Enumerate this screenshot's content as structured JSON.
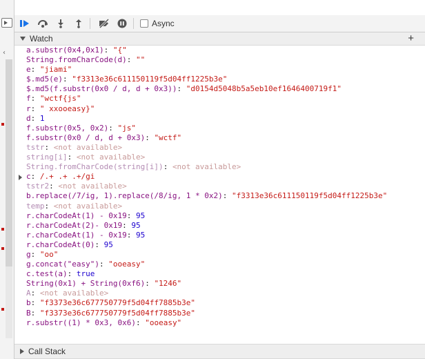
{
  "toolbar": {
    "async_label": "Async"
  },
  "watch": {
    "title": "Watch",
    "add_symbol": "+",
    "items": [
      {
        "expr": "a.substr(0x4,0x1)",
        "value": "\"{\"",
        "kind": "str",
        "na": false
      },
      {
        "expr": "String.fromCharCode(d)",
        "value": "\"\"",
        "kind": "str",
        "na": false
      },
      {
        "expr": "e",
        "value": "\"jiami\"",
        "kind": "str",
        "na": false
      },
      {
        "expr": "$.md5(e)",
        "value": "\"f3313e36c611150119f5d04ff1225b3e\"",
        "kind": "str",
        "na": false
      },
      {
        "expr": "$.md5(f.substr(0x0 / d, d + 0x3))",
        "value": "\"d0154d5048b5a5eb10ef1646400719f1\"",
        "kind": "str",
        "na": false
      },
      {
        "expr": "f",
        "value": "\"wctf{js\"",
        "kind": "str",
        "na": false
      },
      {
        "expr": "r",
        "value": "\" xxooeasy}\"",
        "kind": "str",
        "na": false
      },
      {
        "expr": "d",
        "value": "1",
        "kind": "num",
        "na": false
      },
      {
        "expr": "f.substr(0x5, 0x2)",
        "value": "\"js\"",
        "kind": "str",
        "na": false
      },
      {
        "expr": "f.substr(0x0 / d, d + 0x3)",
        "value": "\"wctf\"",
        "kind": "str",
        "na": false
      },
      {
        "expr": "tstr",
        "value": "<not available>",
        "kind": "na",
        "na": true
      },
      {
        "expr": "string[i]",
        "value": "<not available>",
        "kind": "na",
        "na": true
      },
      {
        "expr": "String.fromCharCode(string[i])",
        "value": "<not available>",
        "kind": "na",
        "na": true
      },
      {
        "expr": "c",
        "value": "/.+ .+ .+/gi",
        "kind": "rx",
        "na": false,
        "expandable": true
      },
      {
        "expr": "tstr2",
        "value": "<not available>",
        "kind": "na",
        "na": true
      },
      {
        "expr": "b.replace(/7/ig, 1).replace(/8/ig, 1 * 0x2)",
        "value": "\"f3313e36c611150119f5d04ff1225b3e\"",
        "kind": "str",
        "na": false
      },
      {
        "expr": "temp",
        "value": "<not available>",
        "kind": "na",
        "na": true
      },
      {
        "expr": "r.charCodeAt(1) - 0x19",
        "value": "95",
        "kind": "num",
        "na": false
      },
      {
        "expr": "r.charCodeAt(2)- 0x19",
        "value": "95",
        "kind": "num",
        "na": false
      },
      {
        "expr": "r.charCodeAt(1) - 0x19",
        "value": "95",
        "kind": "num",
        "na": false
      },
      {
        "expr": "r.charCodeAt(0)",
        "value": "95",
        "kind": "num",
        "na": false
      },
      {
        "expr": "g",
        "value": "\"oo\"",
        "kind": "str",
        "na": false
      },
      {
        "expr": "g.concat(\"easy\")",
        "value": "\"ooeasy\"",
        "kind": "str",
        "na": false
      },
      {
        "expr": "c.test(a)",
        "value": "true",
        "kind": "num",
        "na": false
      },
      {
        "expr": "String(0x1) + String(0xf6)",
        "value": "\"1246\"",
        "kind": "str",
        "na": false
      },
      {
        "expr": "A",
        "value": "<not available>",
        "kind": "na",
        "na": true
      },
      {
        "expr": "b",
        "value": "\"f3373e36c677750779f5d04ff7885b3e\"",
        "kind": "str",
        "na": false
      },
      {
        "expr": "B",
        "value": "\"f3373e36c677750779f5d04ff7885b3e\"",
        "kind": "str",
        "na": false
      },
      {
        "expr": "r.substr((1) * 0x3, 0x6)",
        "value": "\"ooeasy\"",
        "kind": "str",
        "na": false
      }
    ]
  },
  "callstack": {
    "title": "Call Stack"
  }
}
